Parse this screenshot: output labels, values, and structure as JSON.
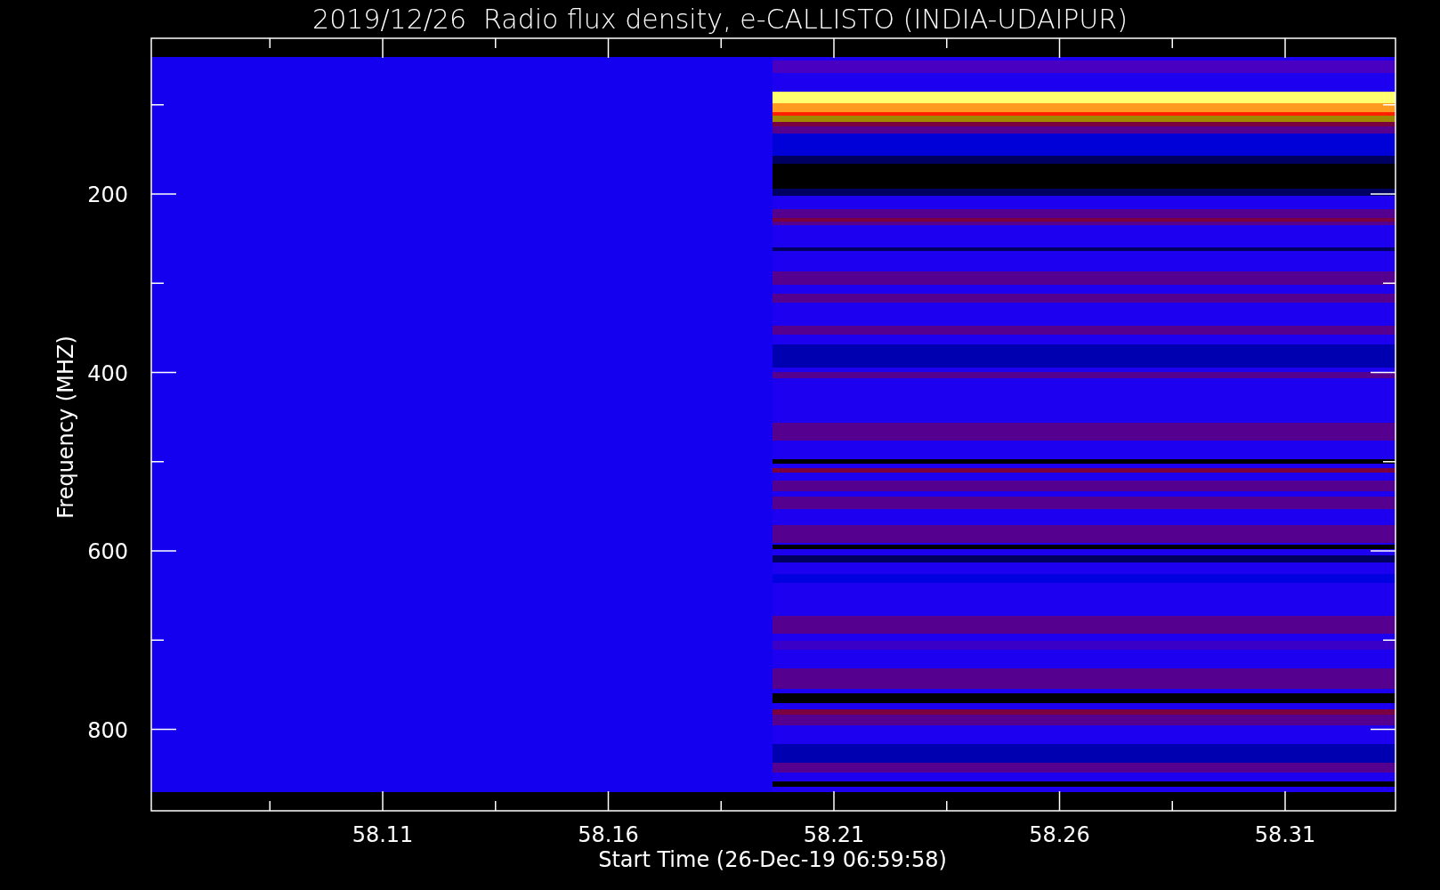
{
  "title": "2019/12/26  Radio flux density, e-CALLISTO (INDIA-UDAIPUR)",
  "xlabel": "Start Time (26-Dec-19 06:59:58)",
  "ylabel": "Frequency (MHZ)",
  "xticks": [
    "58.11",
    "58.16",
    "58.21",
    "58.26",
    "58.31"
  ],
  "yticks": [
    "200",
    "400",
    "600",
    "800"
  ]
}
